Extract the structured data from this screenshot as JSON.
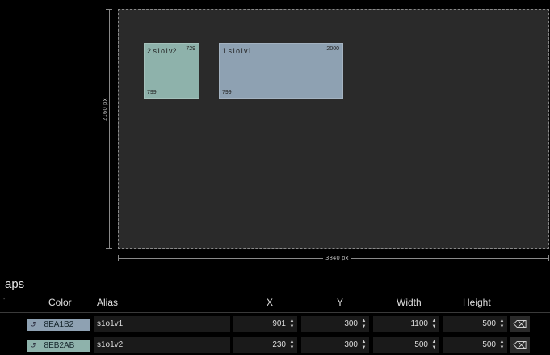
{
  "canvas": {
    "height_label": "2160 px",
    "width_label": "3840 px"
  },
  "maps": [
    {
      "name": "2 s1o1v2",
      "top_right": "729",
      "bottom_left": "799",
      "color": "#8EB2AB"
    },
    {
      "name": "1 s1o1v1",
      "top_right": "2000",
      "bottom_left": "799",
      "color": "#8EA1B2"
    }
  ],
  "section": {
    "title": "aps"
  },
  "table": {
    "headers": {
      "color": "Color",
      "alias": "Alias",
      "x": "X",
      "y": "Y",
      "width": "Width",
      "height": "Height"
    },
    "rows": [
      {
        "color_hex": "8EA1B2",
        "color": "#8EA1B2",
        "alias": "s1o1v1",
        "x": "901",
        "y": "300",
        "width": "1100",
        "height": "500"
      },
      {
        "color_hex": "8EB2AB",
        "color": "#8EB2AB",
        "alias": "s1o1v2",
        "x": "230",
        "y": "300",
        "width": "500",
        "height": "500"
      }
    ]
  },
  "icons": {
    "swatch": "reset-arrow-icon",
    "spin": "spinner-icon",
    "reset": "eraser-icon"
  }
}
